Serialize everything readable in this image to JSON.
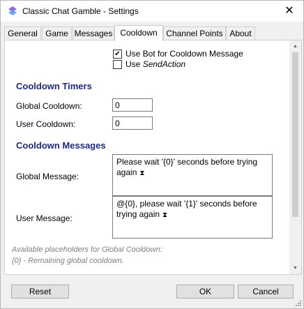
{
  "window": {
    "title": "Classic Chat Gamble - Settings",
    "close_glyph": "✕",
    "icon": "app-logo-icon"
  },
  "tabs": [
    {
      "label": "General",
      "active": false
    },
    {
      "label": "Game",
      "active": false
    },
    {
      "label": "Messages",
      "active": false
    },
    {
      "label": "Cooldown",
      "active": true
    },
    {
      "label": "Channel Points",
      "active": false
    },
    {
      "label": "About",
      "active": false
    }
  ],
  "options": {
    "use_bot_label": "Use Bot for Cooldown Message",
    "use_bot_checked": true,
    "use_sendaction_prefix": "Use ",
    "use_sendaction_em": "SendAction",
    "use_sendaction_checked": false
  },
  "timers": {
    "heading": "Cooldown Timers",
    "global_label": "Global Cooldown:",
    "global_value": "0",
    "user_label": "User Cooldown:",
    "user_value": "0"
  },
  "messages": {
    "heading": "Cooldown Messages",
    "global_label": "Global Message:",
    "global_text": "Please wait '{0}' seconds before trying again",
    "user_label": "User Message:",
    "user_text": "@{0}, please wait '{1}' seconds before trying again",
    "emote_icon": "hourglass-icon"
  },
  "placeholders": {
    "line1": "Available placeholders for Global Cooldown:",
    "line2": "{0} - Remaining global cooldown."
  },
  "buttons": {
    "reset": "Reset",
    "ok": "OK",
    "cancel": "Cancel"
  },
  "colors": {
    "heading": "#1c2a80",
    "hint": "#808080"
  }
}
